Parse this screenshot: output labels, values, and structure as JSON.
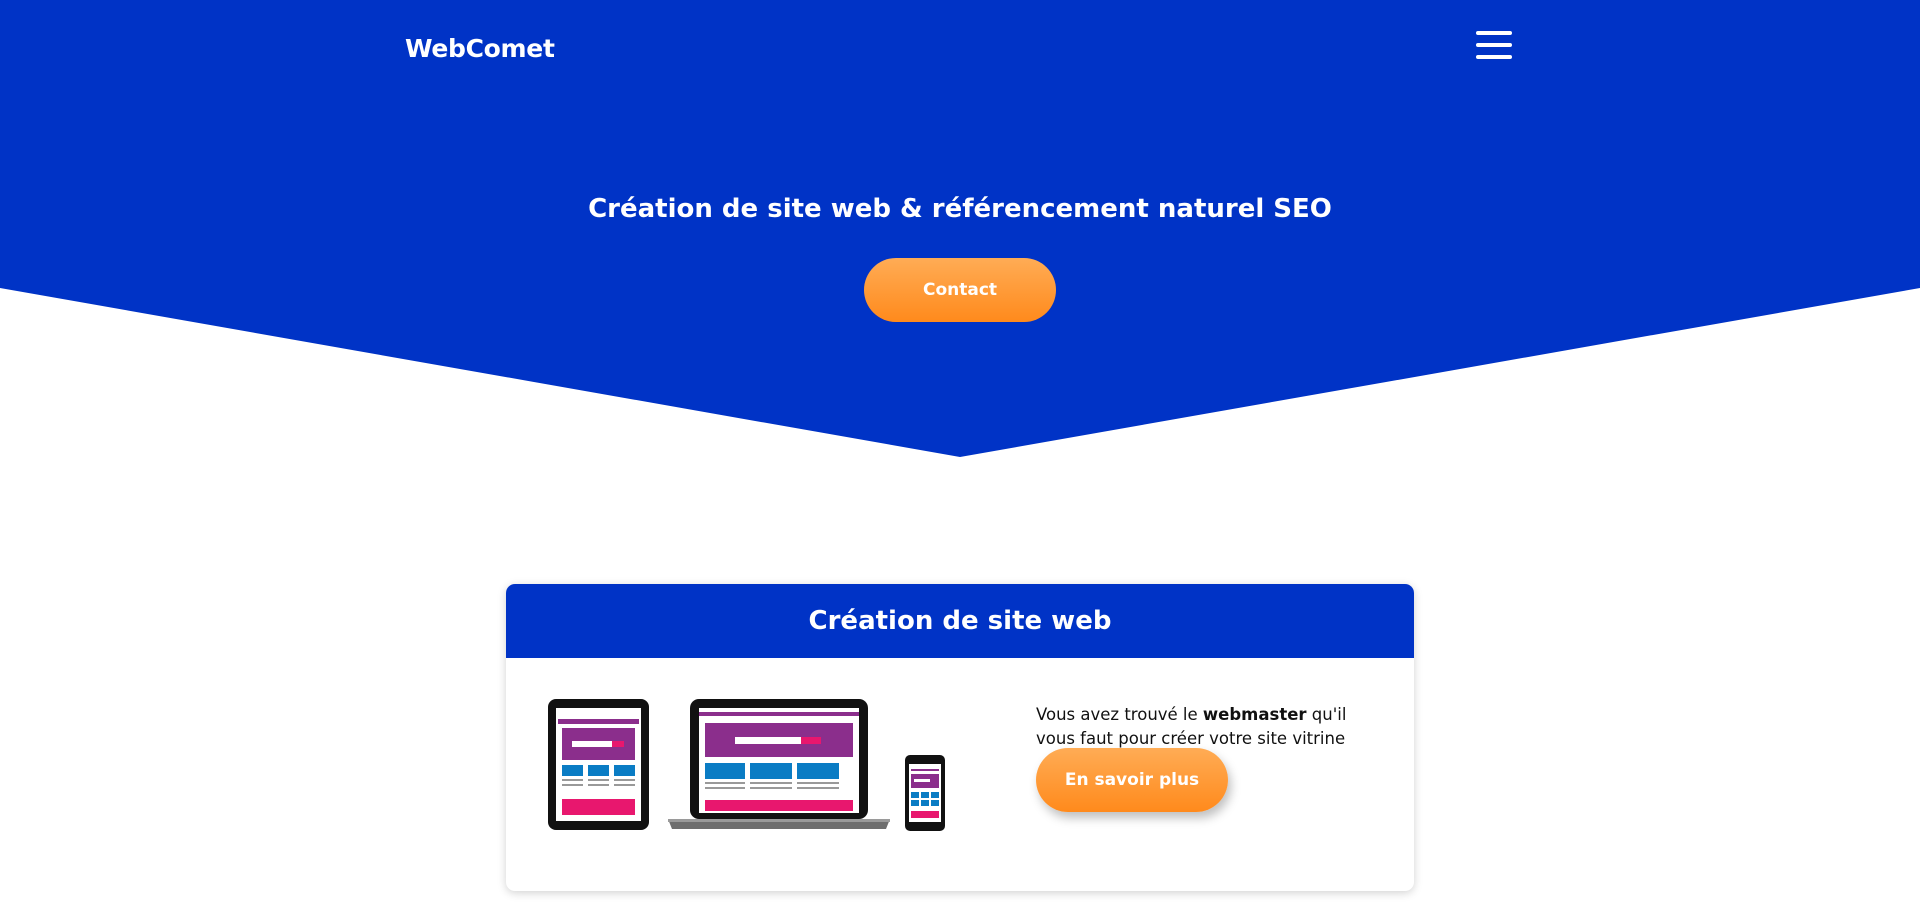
{
  "header": {
    "brand": "WebComet",
    "menu_icon": "hamburger-menu-icon"
  },
  "hero": {
    "title": "Création de site web & référencement naturel SEO",
    "contact_label": "Contact"
  },
  "service_card": {
    "title": "Création de site web",
    "text_before": "Vous avez trouvé le ",
    "text_bold": "webmaster",
    "text_after": " qu'il vous faut pour créer votre site vitrine",
    "button_label": "En savoir plus",
    "illustration": "responsive-devices-illustration"
  },
  "colors": {
    "primary_blue": "#0033c6",
    "accent_orange": "#ff8a1c",
    "device_purple": "#8b2e8c",
    "device_blue": "#0a7cc4",
    "device_pink": "#e8176e"
  }
}
